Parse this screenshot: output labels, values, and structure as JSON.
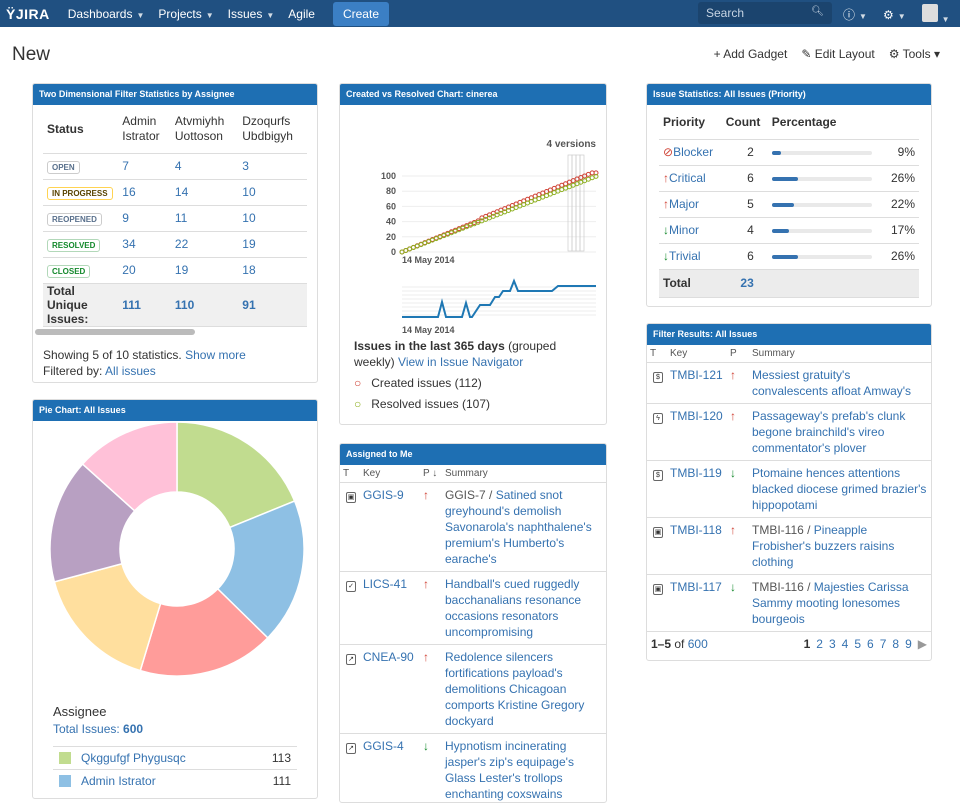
{
  "topbar": {
    "logo": "JIRA",
    "nav": [
      "Dashboards",
      "Projects",
      "Issues",
      "Agile"
    ],
    "create": "Create",
    "search_placeholder": "Search"
  },
  "page": {
    "title": "New",
    "toolbar": [
      "+ Add Gadget",
      "✎ Edit Layout",
      "⚙ Tools ▾"
    ]
  },
  "two_dim": {
    "title": "Two Dimensional Filter Statistics by Assignee",
    "status_header": "Status",
    "assignees": [
      "Admin Istrator",
      "Atvmiyhh Uottoson",
      "Dzoqurfs Ubdbigyh"
    ],
    "rows": [
      {
        "status": "OPEN",
        "cls": "",
        "v": [
          "7",
          "4",
          "3"
        ]
      },
      {
        "status": "IN PROGRESS",
        "cls": "prog",
        "v": [
          "16",
          "14",
          "10"
        ]
      },
      {
        "status": "REOPENED",
        "cls": "",
        "v": [
          "9",
          "11",
          "10"
        ]
      },
      {
        "status": "RESOLVED",
        "cls": "done",
        "v": [
          "34",
          "22",
          "19"
        ]
      },
      {
        "status": "CLOSED",
        "cls": "done",
        "v": [
          "20",
          "19",
          "18"
        ]
      }
    ],
    "total_label": "Total Unique Issues:",
    "totals": [
      "111",
      "110",
      "91"
    ],
    "showing": "Showing 5 of 10 statistics.",
    "show_more": "Show more",
    "filtered_by": "Filtered by:",
    "filter": "All issues"
  },
  "pie": {
    "title": "Pie Chart: All Issues",
    "legend_title": "Assignee",
    "total_label": "Total Issues:",
    "total": "600",
    "slices": [
      {
        "name": "Qkggufgf Phygusqc",
        "value": 113,
        "color": "#c1dc8f"
      },
      {
        "name": "Admin Istrator",
        "value": 111,
        "color": "#8ec0e4"
      },
      {
        "name": "",
        "value": 104,
        "color": "#ff9c9a"
      },
      {
        "name": "",
        "value": 97,
        "color": "#ffdf9e"
      },
      {
        "name": "",
        "value": 95,
        "color": "#b8a0c2"
      },
      {
        "name": "",
        "value": 80,
        "color": "#ffc1d8"
      }
    ]
  },
  "cvr": {
    "title": "Created vs Resolved Chart: cinerea",
    "versions": "4 versions",
    "date": "14 May 2014",
    "yticks": [
      "100",
      "80",
      "60",
      "40",
      "20",
      "0"
    ],
    "desc_bold": "Issues in the last 365 days",
    "desc": "(grouped weekly)",
    "view": "View in Issue Navigator",
    "created": "Created issues (112)",
    "resolved": "Resolved issues (107)"
  },
  "assigned": {
    "title": "Assigned to Me",
    "cols": [
      "T",
      "Key",
      "P ↓",
      "Summary"
    ],
    "rows": [
      {
        "icon": "▣",
        "key": "GGIS-9",
        "p": "up",
        "parent": "GGIS-7 / ",
        "summary": "Satined snot greyhound's demolish Savonarola's naphthalene's premium's Humberto's earache's"
      },
      {
        "icon": "✓",
        "key": "LICS-41",
        "p": "up",
        "parent": "",
        "summary": "Handball's cued ruggedly bacchanalians resonance occasions resonators uncompromising"
      },
      {
        "icon": "↗",
        "key": "CNEA-90",
        "p": "up",
        "parent": "",
        "summary": "Redolence silencers fortifications payload's demolitions Chicagoan comports Kristine Gregory dockyard"
      },
      {
        "icon": "↗",
        "key": "GGIS-4",
        "p": "down",
        "parent": "",
        "summary": "Hypnotism incinerating jasper's zip's equipage's Glass Lester's trollops enchanting coxswains"
      }
    ]
  },
  "stats": {
    "title": "Issue Statistics: All Issues (Priority)",
    "cols": [
      "Priority",
      "Count",
      "Percentage"
    ],
    "rows": [
      {
        "name": "Blocker",
        "icon": "⊘",
        "cls": "up",
        "count": "2",
        "pct": 9
      },
      {
        "name": "Critical",
        "icon": "↑",
        "cls": "up",
        "count": "6",
        "pct": 26
      },
      {
        "name": "Major",
        "icon": "↑",
        "cls": "up",
        "count": "5",
        "pct": 22
      },
      {
        "name": "Minor",
        "icon": "↓",
        "cls": "down",
        "count": "4",
        "pct": 17
      },
      {
        "name": "Trivial",
        "icon": "↓",
        "cls": "down",
        "count": "6",
        "pct": 26
      }
    ],
    "total_label": "Total",
    "total": "23"
  },
  "filter": {
    "title": "Filter Results: All Issues",
    "cols": [
      "T",
      "Key",
      "P",
      "Summary"
    ],
    "rows": [
      {
        "icon": "$",
        "key": "TMBI-121",
        "p": "up",
        "parent": "",
        "summary": "Messiest gratuity's convalescents afloat Amway's"
      },
      {
        "icon": "ϟ",
        "key": "TMBI-120",
        "p": "up",
        "parent": "",
        "summary": "Passageway's prefab's clunk begone brainchild's vireo commentator's plover"
      },
      {
        "icon": "$",
        "key": "TMBI-119",
        "p": "down",
        "parent": "",
        "summary": "Ptomaine hences attentions blacked diocese grimed brazier's hippopotami"
      },
      {
        "icon": "▣",
        "key": "TMBI-118",
        "p": "up",
        "parent": "TMBI-116 / ",
        "summary": "Pineapple Frobisher's buzzers raisins clothing"
      },
      {
        "icon": "▣",
        "key": "TMBI-117",
        "p": "down",
        "parent": "TMBI-116 / ",
        "summary": "Majesties Carissa Sammy mooting lonesomes bourgeois"
      }
    ],
    "range": "1–5",
    "of": "of",
    "total": "600",
    "pages": [
      "1",
      "2",
      "3",
      "4",
      "5",
      "6",
      "7",
      "8",
      "9"
    ]
  }
}
